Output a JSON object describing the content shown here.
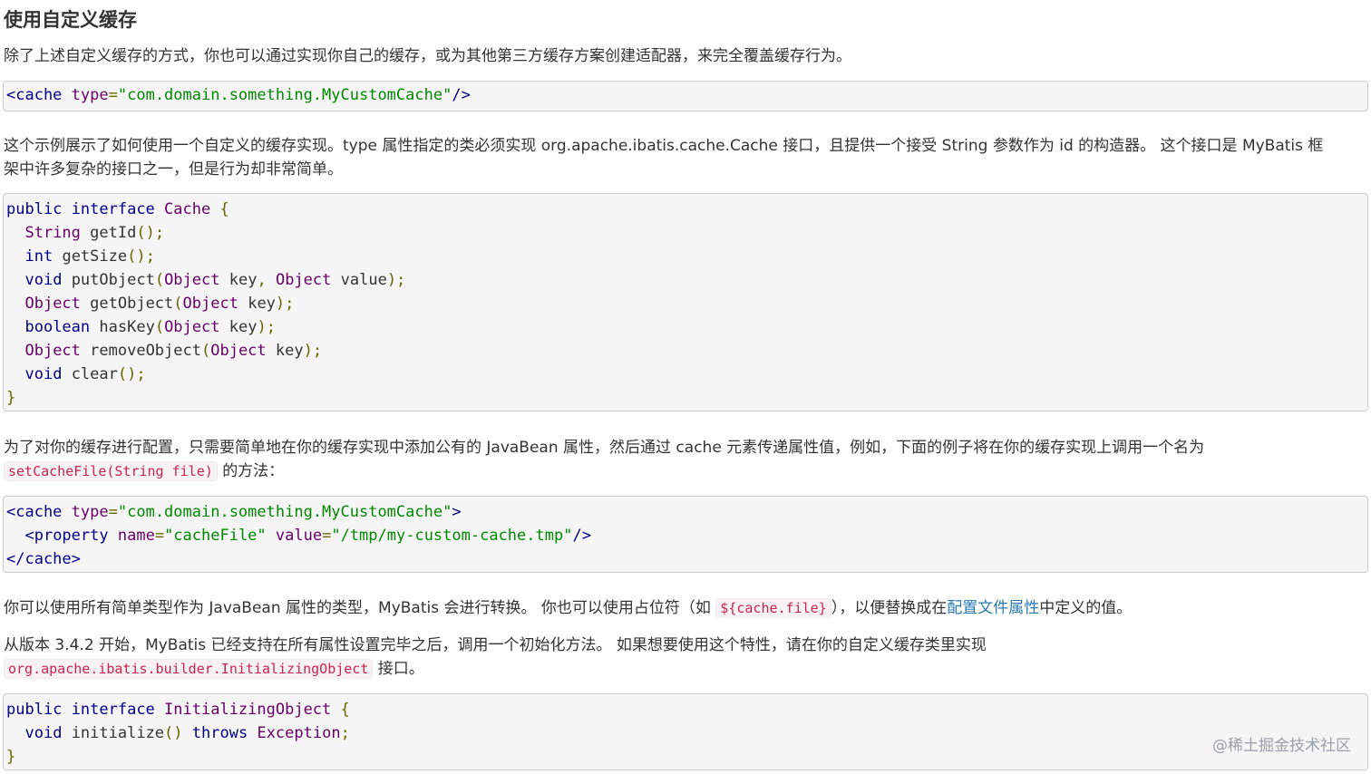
{
  "heading": "使用自定义缓存",
  "p1": "除了上述自定义缓存的方式，你也可以通过实现你自己的缓存，或为其他第三方缓存方案创建适配器，来完全覆盖缓存行为。",
  "code1": {
    "tag_open": "<cache",
    "attr": "type",
    "eq": "=",
    "value": "\"com.domain.something.MyCustomCache\"",
    "tag_close": "/>"
  },
  "p2": {
    "line1": "这个示例展示了如何使用一个自定义的缓存实现。type 属性指定的类必须实现 org.apache.ibatis.cache.Cache 接口，且提供一个接受 String 参数作为 id 的构造器。 这个接口是 MyBatis 框",
    "line2": "架中许多复杂的接口之一，但是行为却非常简单。"
  },
  "code2": {
    "l1": {
      "kw1": "public",
      "kw2": "interface",
      "name": "Cache",
      "brace": "{"
    },
    "l2": {
      "type": "String",
      "name": "getId",
      "punc": "();"
    },
    "l3": {
      "type": "int",
      "name": "getSize",
      "punc": "();"
    },
    "l4": {
      "type": "void",
      "name": "putObject",
      "p1": "(",
      "t1": "Object",
      "a1": "key",
      "c": ",",
      "t2": "Object",
      "a2": "value",
      "end": ");"
    },
    "l5": {
      "type": "Object",
      "name": "getObject",
      "p1": "(",
      "t1": "Object",
      "a1": "key",
      "end": ");"
    },
    "l6": {
      "type": "boolean",
      "name": "hasKey",
      "p1": "(",
      "t1": "Object",
      "a1": "key",
      "end": ");"
    },
    "l7": {
      "type": "Object",
      "name": "removeObject",
      "p1": "(",
      "t1": "Object",
      "a1": "key",
      "end": ");"
    },
    "l8": {
      "type": "void",
      "name": "clear",
      "punc": "();"
    },
    "l9": {
      "brace": "}"
    }
  },
  "p3": {
    "line1": "为了对你的缓存进行配置，只需要简单地在你的缓存实现中添加公有的 JavaBean 属性，然后通过 cache 元素传递属性值，例如，下面的例子将在你的缓存实现上调用一个名为",
    "code": "setCacheFile(String file)",
    "after": "的方法："
  },
  "code3": {
    "l1": {
      "tag": "<cache",
      "attr": "type",
      "eq": "=",
      "value": "\"com.domain.something.MyCustomCache\"",
      "close": ">"
    },
    "l2": {
      "tag": "<property",
      "attr1": "name",
      "eq1": "=",
      "val1": "\"cacheFile\"",
      "attr2": "value",
      "eq2": "=",
      "val2": "\"/tmp/my-custom-cache.tmp\"",
      "close": "/>"
    },
    "l3": {
      "tag": "</cache>"
    }
  },
  "p4": {
    "before": "你可以使用所有简单类型作为 JavaBean 属性的类型，MyBatis 会进行转换。 你也可以使用占位符（如",
    "code": "${cache.file}",
    "mid": "），以便替换成在",
    "link": "配置文件属性",
    "after": "中定义的值。"
  },
  "p5": {
    "line1": "从版本 3.4.2 开始，MyBatis 已经支持在所有属性设置完毕之后，调用一个初始化方法。 如果想要使用这个特性，请在你的自定义缓存类里实现",
    "code": "org.apache.ibatis.builder.InitializingObject",
    "after": "接口。"
  },
  "code4": {
    "l1": {
      "kw1": "public",
      "kw2": "interface",
      "name": "InitializingObject",
      "brace": "{"
    },
    "l2": {
      "type": "void",
      "name": "initialize",
      "punc": "()",
      "kw": "throws",
      "exc": "Exception",
      "semi": ";"
    },
    "l3": {
      "brace": "}"
    }
  },
  "watermark": "@稀土掘金技术社区"
}
